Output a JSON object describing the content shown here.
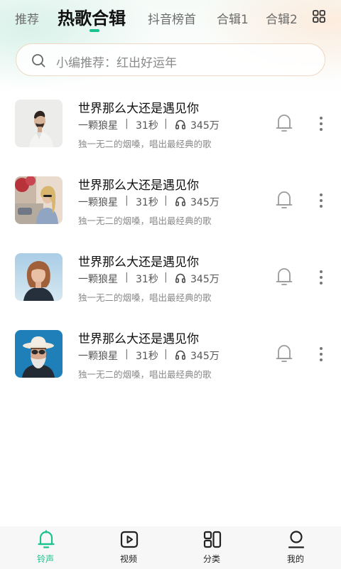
{
  "tabs": [
    {
      "label": "推荐"
    },
    {
      "label": "热歌合辑",
      "active": true
    },
    {
      "label": "抖音榜首"
    },
    {
      "label": "合辑1"
    },
    {
      "label": "合辑2"
    }
  ],
  "search": {
    "placeholder": "小编推荐：红出好运年"
  },
  "songs": [
    {
      "title": "世界那么大还是遇见你",
      "artist": "一颗狼星",
      "duration": "31秒",
      "plays": "345万",
      "desc": "独一无二的烟嗓，唱出最经典的歌"
    },
    {
      "title": "世界那么大还是遇见你",
      "artist": "一颗狼星",
      "duration": "31秒",
      "plays": "345万",
      "desc": "独一无二的烟嗓，唱出最经典的歌"
    },
    {
      "title": "世界那么大还是遇见你",
      "artist": "一颗狼星",
      "duration": "31秒",
      "plays": "345万",
      "desc": "独一无二的烟嗓，唱出最经典的歌"
    },
    {
      "title": "世界那么大还是遇见你",
      "artist": "一颗狼星",
      "duration": "31秒",
      "plays": "345万",
      "desc": "独一无二的烟嗓，唱出最经典的歌"
    }
  ],
  "separator": "|",
  "bottom_nav": [
    {
      "label": "铃声",
      "icon": "bell-icon",
      "active": true
    },
    {
      "label": "视频",
      "icon": "video-icon"
    },
    {
      "label": "分类",
      "icon": "category-icon"
    },
    {
      "label": "我的",
      "icon": "profile-icon"
    }
  ],
  "colors": {
    "accent": "#19c28e",
    "title": "#111111",
    "secondary": "#8a8a8a"
  }
}
